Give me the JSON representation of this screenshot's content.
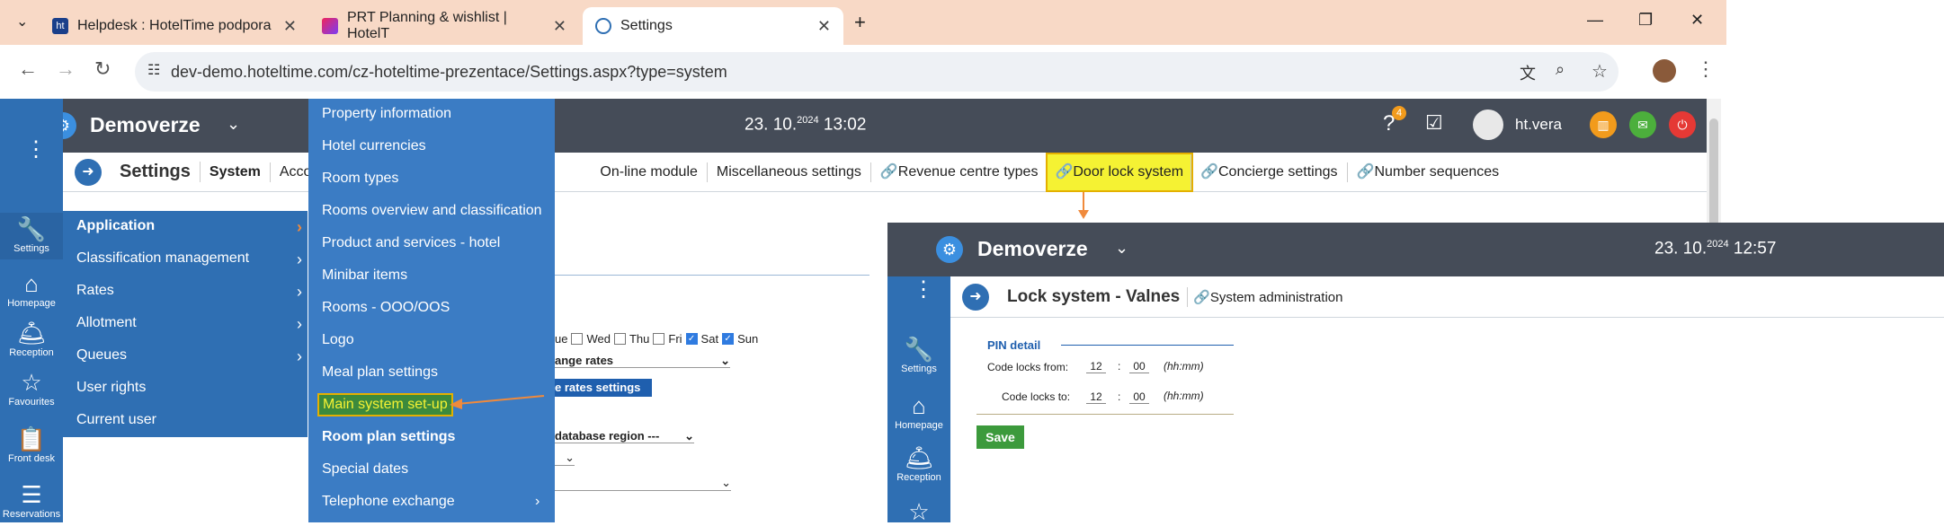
{
  "browser": {
    "tabs": [
      {
        "title": "Helpdesk : HotelTime podpora",
        "icon": "hoteltime-icon"
      },
      {
        "title": "PRT Planning & wishlist | HotelT",
        "icon": "clickup-icon"
      },
      {
        "title": "Settings",
        "icon": "app-icon"
      }
    ],
    "new_tab": "+",
    "url": "dev-demo.hoteltime.com/cz-hoteltime-prezentace/Settings.aspx?type=system"
  },
  "app": {
    "property": "Demoverze",
    "date_main": "23. 10.",
    "year_sup": "2024",
    "time": "13:02",
    "help_badge": "4",
    "user": "ht.vera",
    "sidebar": [
      {
        "label": "Settings",
        "icon": "wrench-icon"
      },
      {
        "label": "Homepage",
        "icon": "home-icon"
      },
      {
        "label": "Reception",
        "icon": "bell-icon"
      },
      {
        "label": "Favourites",
        "icon": "star-icon"
      },
      {
        "label": "Front desk",
        "icon": "clipboard-icon"
      },
      {
        "label": "Reservations",
        "icon": "sliders-icon"
      }
    ],
    "settings_bar": {
      "title": "Settings",
      "tabs": [
        "System",
        "Acco",
        "On-line module",
        "Miscellaneous settings",
        "Revenue centre types",
        "Door lock system",
        "Concierge settings",
        "Number sequences"
      ]
    }
  },
  "menu_level1": [
    {
      "label": "Application",
      "has_sub": true
    },
    {
      "label": "Classification management",
      "has_sub": true
    },
    {
      "label": "Rates",
      "has_sub": true
    },
    {
      "label": "Allotment",
      "has_sub": true
    },
    {
      "label": "Queues",
      "has_sub": true
    },
    {
      "label": "User rights",
      "has_sub": false
    },
    {
      "label": "Current user",
      "has_sub": false
    }
  ],
  "menu_level2": [
    "Property information",
    "Hotel currencies",
    "Room types",
    "Rooms overview and classification",
    "Product and services - hotel",
    "Minibar items",
    "Rooms - OOO/OOS",
    "Logo",
    "Meal plan settings",
    "Main system set-up",
    "Room plan settings",
    "Special dates",
    "Telephone exchange"
  ],
  "behind_form": {
    "days": [
      "ue",
      "Wed",
      "Thu",
      "Fri",
      "Sat",
      "Sun"
    ],
    "select1": "ange rates",
    "button": "e rates settings",
    "select2": "database region ---"
  },
  "inset": {
    "property": "Demoverze",
    "date_main": "23. 10.",
    "year_sup": "2024",
    "time": "12:57",
    "page_title": "Lock system - Valnes",
    "link": "System administration",
    "section": "PIN detail",
    "from_label": "Code locks from:",
    "to_label": "Code locks to:",
    "from_h": "12",
    "from_m": "00",
    "to_h": "12",
    "to_m": "00",
    "colon": ":",
    "hint": "(hh:mm)",
    "save": "Save",
    "sidebar": [
      "Settings",
      "Homepage",
      "Reception"
    ]
  },
  "colors": {
    "accent": "#2f6fb3",
    "highlight": "#f5f233",
    "arrow": "#f08a3c",
    "save": "#3c9a3c"
  }
}
